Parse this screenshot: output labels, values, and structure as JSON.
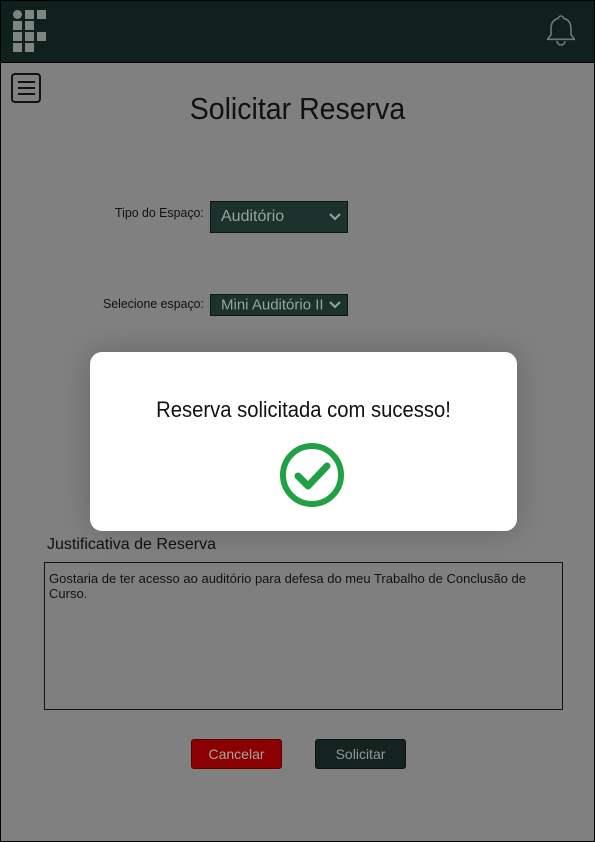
{
  "header": {
    "logo_icon": "ifpe-logo-icon",
    "notification_icon": "bell-icon"
  },
  "menu": {
    "icon": "hamburger-menu-icon"
  },
  "page": {
    "title": "Solicitar Reserva"
  },
  "form": {
    "space_type_label": "Tipo do Espaço:",
    "space_type_value": "Auditório",
    "space_label": "Selecione espaço:",
    "space_value": "Mini Auditório II",
    "justification_label": "Justificativa de Reserva",
    "justification_value": "Gostaria de ter acesso ao auditório para defesa do meu Trabalho de Conclusão de Curso."
  },
  "buttons": {
    "cancel_label": "Cancelar",
    "submit_label": "Solicitar"
  },
  "modal": {
    "message": "Reserva solicitada com sucesso!",
    "icon": "success-check-icon",
    "icon_color": "#22a045"
  },
  "colors": {
    "header_bg": "#10211d",
    "select_bg": "#1b332c",
    "cancel_bg": "#8b0000"
  }
}
